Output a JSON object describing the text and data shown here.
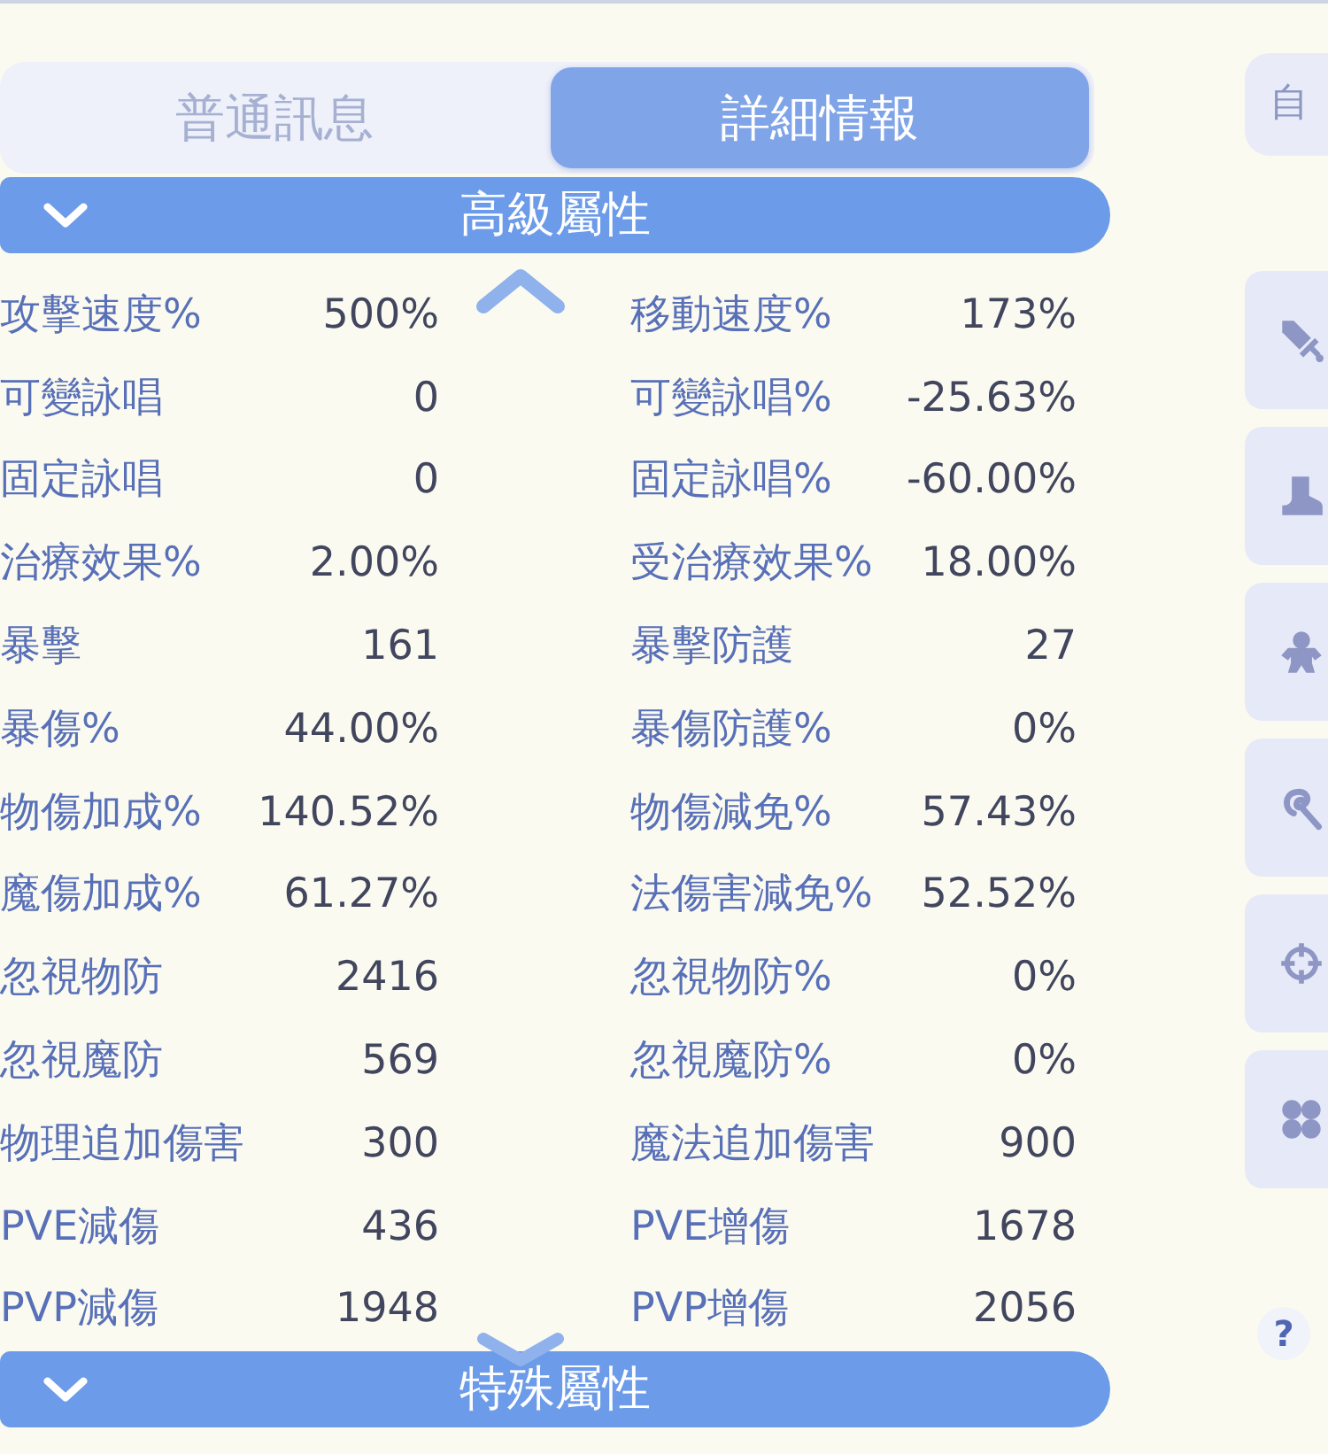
{
  "tabs": [
    {
      "label": "普通訊息",
      "selected": false
    },
    {
      "label": "詳細情報",
      "selected": true
    }
  ],
  "sections": [
    {
      "title": "高級屬性",
      "rows": [
        {
          "left": {
            "label": "攻擊速度%",
            "value": "500%"
          },
          "right": {
            "label": "移動速度%",
            "value": "173%"
          }
        },
        {
          "left": {
            "label": "可變詠唱",
            "value": "0"
          },
          "right": {
            "label": "可變詠唱%",
            "value": "-25.63%"
          }
        },
        {
          "left": {
            "label": "固定詠唱",
            "value": "0"
          },
          "right": {
            "label": "固定詠唱%",
            "value": "-60.00%"
          }
        },
        {
          "left": {
            "label": "治療效果%",
            "value": "2.00%"
          },
          "right": {
            "label": "受治療效果%",
            "value": "18.00%"
          }
        },
        {
          "left": {
            "label": "暴擊",
            "value": "161"
          },
          "right": {
            "label": "暴擊防護",
            "value": "27"
          }
        },
        {
          "left": {
            "label": "暴傷%",
            "value": "44.00%"
          },
          "right": {
            "label": "暴傷防護%",
            "value": "0%"
          }
        },
        {
          "left": {
            "label": "物傷加成%",
            "value": "140.52%"
          },
          "right": {
            "label": "物傷減免%",
            "value": "57.43%"
          }
        },
        {
          "left": {
            "label": "魔傷加成%",
            "value": "61.27%"
          },
          "right": {
            "label": "法傷害減免%",
            "value": "52.52%"
          }
        },
        {
          "left": {
            "label": "忽視物防",
            "value": "2416"
          },
          "right": {
            "label": "忽視物防%",
            "value": "0%"
          }
        },
        {
          "left": {
            "label": "忽視魔防",
            "value": "569"
          },
          "right": {
            "label": "忽視魔防%",
            "value": "0%"
          }
        },
        {
          "left": {
            "label": "物理追加傷害",
            "value": "300"
          },
          "right": {
            "label": "魔法追加傷害",
            "value": "900"
          }
        },
        {
          "left": {
            "label": "PVE減傷",
            "value": "436"
          },
          "right": {
            "label": "PVE增傷",
            "value": "1678"
          }
        },
        {
          "left": {
            "label": "PVP減傷",
            "value": "1948"
          },
          "right": {
            "label": "PVP增傷",
            "value": "2056"
          }
        }
      ]
    },
    {
      "title": "特殊屬性"
    }
  ],
  "side_panel": {
    "auto_button": {
      "label": "自"
    },
    "help_button": {
      "label": "?"
    }
  }
}
